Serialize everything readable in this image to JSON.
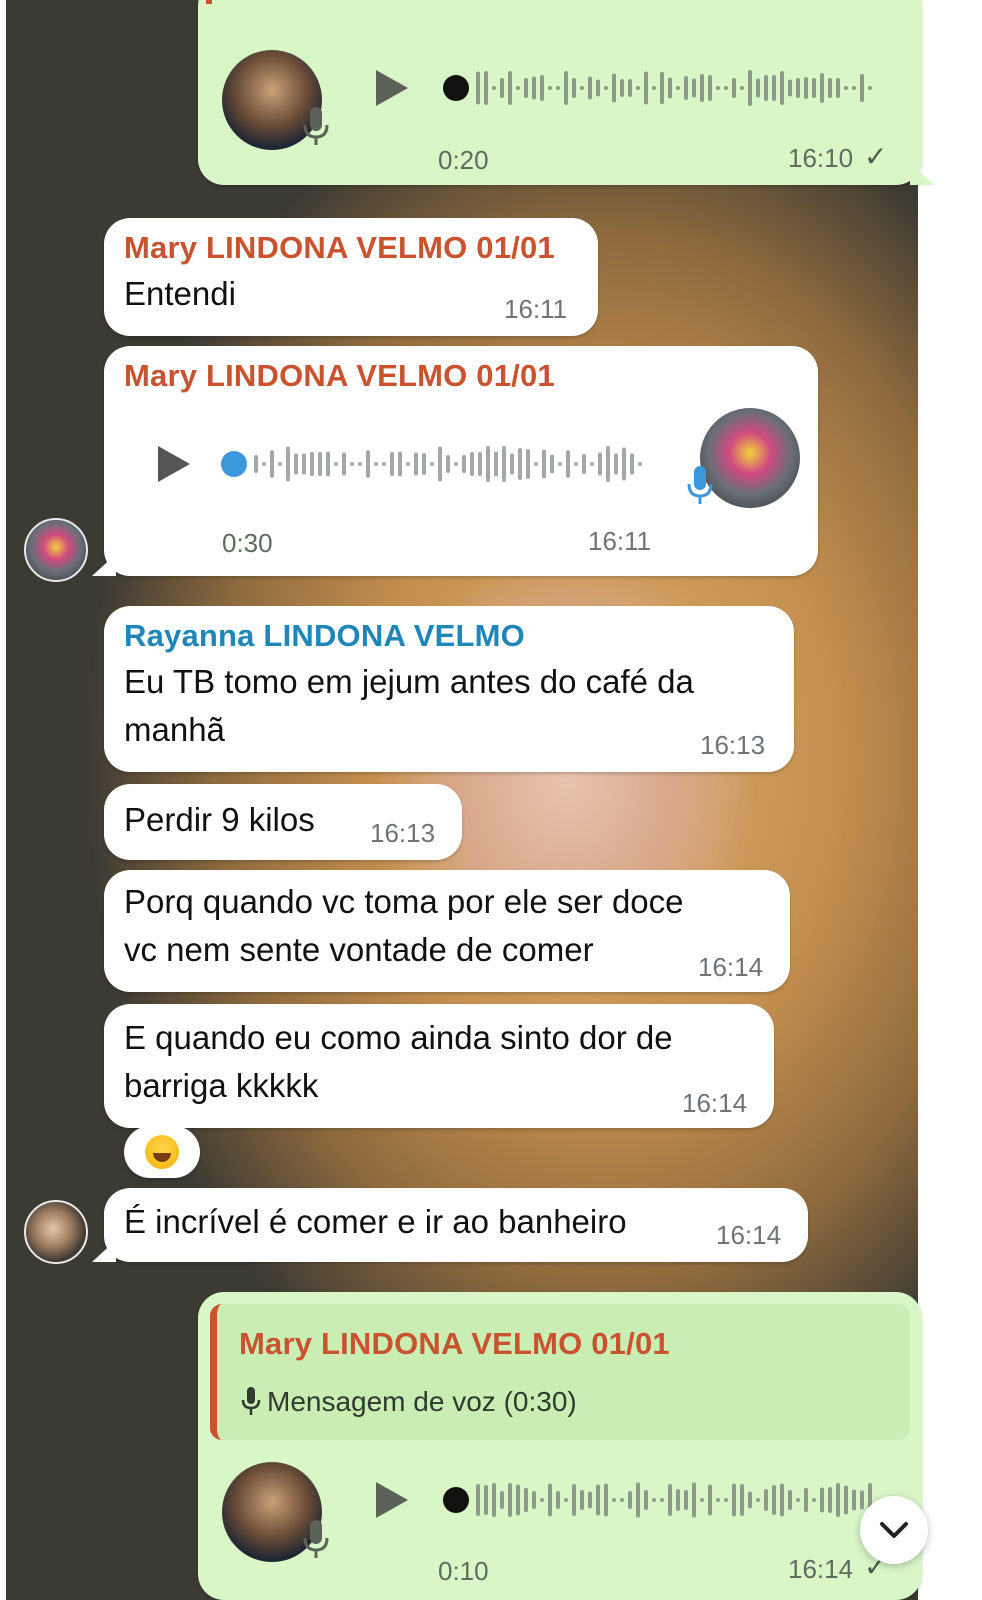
{
  "messages": {
    "voice1": {
      "duration": "0:20",
      "time": "16:10",
      "status": "✓"
    },
    "m1": {
      "sender": "Mary LINDONA VELMO 01/01",
      "text": "Entendi",
      "time": "16:11"
    },
    "voice2": {
      "sender": "Mary LINDONA VELMO 01/01",
      "duration": "0:30",
      "time": "16:11"
    },
    "m2": {
      "sender": "Rayanna LINDONA VELMO",
      "line1": "Eu TB tomo em jejum antes do café da",
      "line2": "manhã",
      "time": "16:13"
    },
    "m3": {
      "text": "Perdir 9 kilos",
      "time": "16:13"
    },
    "m4": {
      "line1": "Porq quando vc toma por ele ser doce",
      "line2": "vc nem sente vontade de comer",
      "time": "16:14"
    },
    "m5": {
      "line1": "E quando eu como ainda sinto dor de",
      "line2": "barriga kkkkk",
      "time": "16:14"
    },
    "reaction": {
      "emoji": "😂"
    },
    "m6": {
      "text": "É incrível é comer e ir ao banheiro",
      "time": "16:14"
    },
    "voice3": {
      "quote_sender": "Mary LINDONA VELMO 01/01",
      "quote_text": "Mensagem de voz (0:30)",
      "duration": "0:10",
      "time": "16:14",
      "status": "✓"
    }
  },
  "icons": {
    "play": "play-icon",
    "mic": "microphone-icon",
    "check": "checkmark-icon",
    "scroll": "chevron-down-icon"
  },
  "colors": {
    "outgoing_bubble": "#d9f6c7",
    "incoming_bubble": "#ffffff",
    "mary_name": "#c8532e",
    "rayanna_name": "#1f86b8"
  }
}
